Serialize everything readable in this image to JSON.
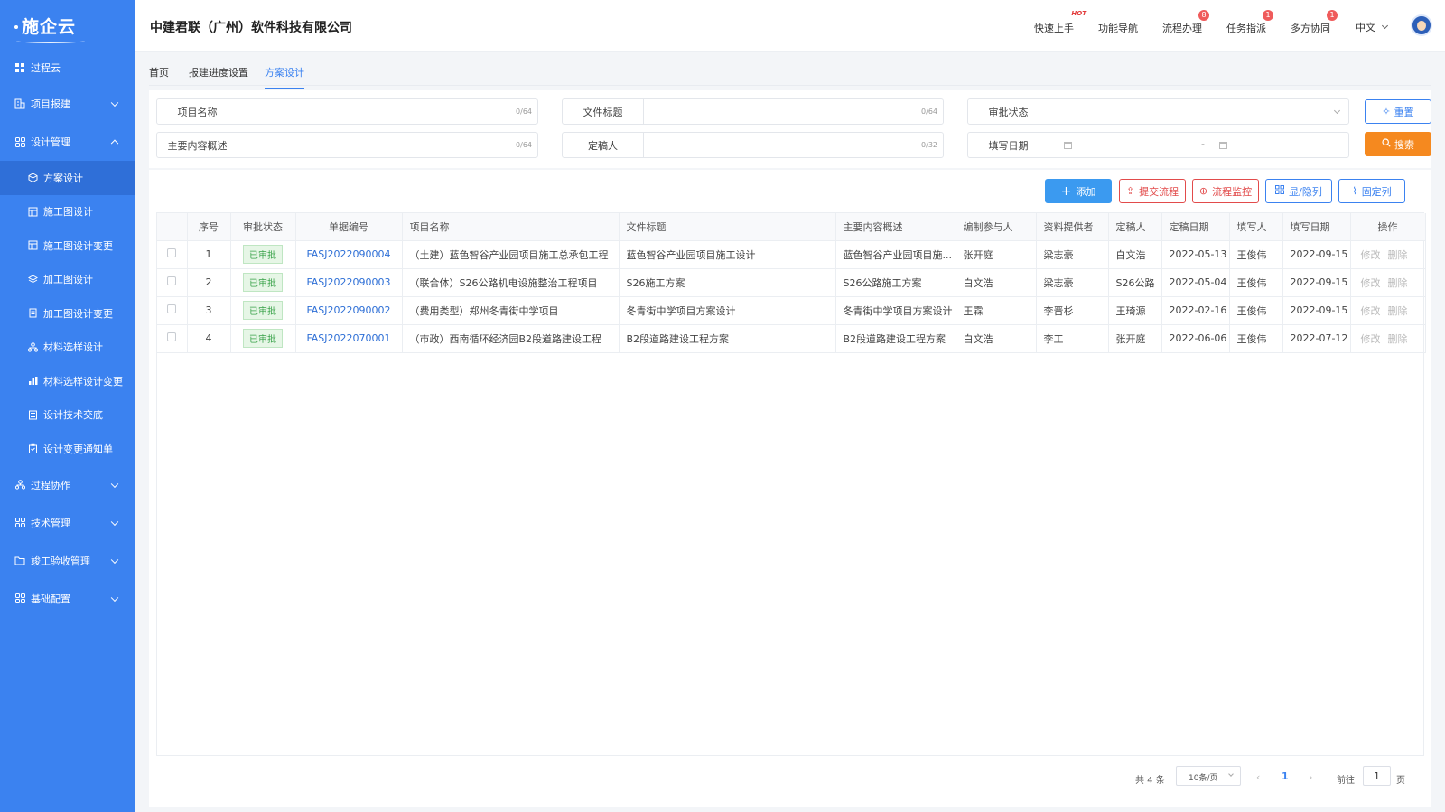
{
  "app": {
    "logo": "施企云",
    "company": "中建君联（广州）软件科技有限公司"
  },
  "colors": {
    "primary": "#3b82f0",
    "sidebar": "#3b82f0",
    "search": "#f5891f",
    "danger": "#e24b4b",
    "approved": "#3aa34a"
  },
  "header": {
    "quick_start": "快速上手",
    "quick_start_badge": "HOT",
    "func_nav": "功能导航",
    "process": "流程办理",
    "process_badge": "8",
    "task": "任务指派",
    "task_badge": "1",
    "collab": "多方协同",
    "collab_badge": "1",
    "lang": "中文"
  },
  "sidebar": {
    "home": "过程云",
    "items": [
      {
        "label": "项目报建",
        "icon": "building-icon"
      },
      {
        "label": "设计管理",
        "icon": "grid-icon"
      },
      {
        "label": "过程协作",
        "icon": "org-icon"
      },
      {
        "label": "技术管理",
        "icon": "grid-icon"
      },
      {
        "label": "竣工验收管理",
        "icon": "folder-icon"
      },
      {
        "label": "基础配置",
        "icon": "grid-icon"
      }
    ],
    "sub": [
      {
        "label": "方案设计"
      },
      {
        "label": "施工图设计"
      },
      {
        "label": "施工图设计变更"
      },
      {
        "label": "加工图设计"
      },
      {
        "label": "加工图设计变更"
      },
      {
        "label": "材料选样设计"
      },
      {
        "label": "材料选样设计变更"
      },
      {
        "label": "设计技术交底"
      },
      {
        "label": "设计变更通知单"
      }
    ]
  },
  "tabs": [
    "首页",
    "报建进度设置",
    "方案设计"
  ],
  "filters": {
    "project_name": {
      "label": "项目名称",
      "count": "0/64"
    },
    "doc_title": {
      "label": "文件标题",
      "count": "0/64"
    },
    "approval_status": {
      "label": "审批状态"
    },
    "main_content": {
      "label": "主要内容概述",
      "count": "0/64"
    },
    "finalizer": {
      "label": "定稿人",
      "count": "0/32"
    },
    "fill_date": {
      "label": "填写日期",
      "separator": "-"
    },
    "reset": "重置",
    "search": "搜索"
  },
  "toolbar": {
    "add": "添加",
    "submit": "提交流程",
    "monitor": "流程监控",
    "toggle_cols": "显/隐列",
    "fix_cols": "固定列"
  },
  "table": {
    "headers": [
      "序号",
      "审批状态",
      "单据编号",
      "项目名称",
      "文件标题",
      "主要内容概述",
      "编制参与人",
      "资料提供者",
      "定稿人",
      "定稿日期",
      "填写人",
      "填写日期",
      "操作"
    ],
    "rows": [
      {
        "no": "1",
        "status": "已审批",
        "code": "FASJ2022090004",
        "project": "（土建）蓝色智谷产业园项目施工总承包工程",
        "title": "蓝色智谷产业园项目施工设计",
        "summary": "蓝色智谷产业园项目施...",
        "author": "张开庭",
        "provider": "梁志豪",
        "finalizer": "白文浩",
        "final_date": "2022-05-13",
        "filler": "王俊伟",
        "fill_date": "2022-09-15",
        "edit": "修改",
        "del": "删除"
      },
      {
        "no": "2",
        "status": "已审批",
        "code": "FASJ2022090003",
        "project": "（联合体）S26公路机电设施整治工程项目",
        "title": "S26施工方案",
        "summary": "S26公路施工方案",
        "author": "白文浩",
        "provider": "梁志豪",
        "finalizer": "S26公路",
        "final_date": "2022-05-04",
        "filler": "王俊伟",
        "fill_date": "2022-09-15",
        "edit": "修改",
        "del": "删除"
      },
      {
        "no": "3",
        "status": "已审批",
        "code": "FASJ2022090002",
        "project": "（费用类型）郑州冬青街中学项目",
        "title": "冬青街中学项目方案设计",
        "summary": "冬青街中学项目方案设计",
        "author": "王霖",
        "provider": "李晋杉",
        "finalizer": "王琦源",
        "final_date": "2022-02-16",
        "filler": "王俊伟",
        "fill_date": "2022-09-15",
        "edit": "修改",
        "del": "删除"
      },
      {
        "no": "4",
        "status": "已审批",
        "code": "FASJ2022070001",
        "project": "（市政）西南循环经济园B2段道路建设工程",
        "title": "B2段道路建设工程方案",
        "summary": "B2段道路建设工程方案",
        "author": "白文浩",
        "provider": "李工",
        "finalizer": "张开庭",
        "final_date": "2022-06-06",
        "filler": "王俊伟",
        "fill_date": "2022-07-12",
        "edit": "修改",
        "del": "删除"
      }
    ]
  },
  "pagination": {
    "total": "共 4 条",
    "page_size": "10条/页",
    "current": "1",
    "goto_label": "前往",
    "goto_value": "1",
    "page_unit": "页"
  }
}
